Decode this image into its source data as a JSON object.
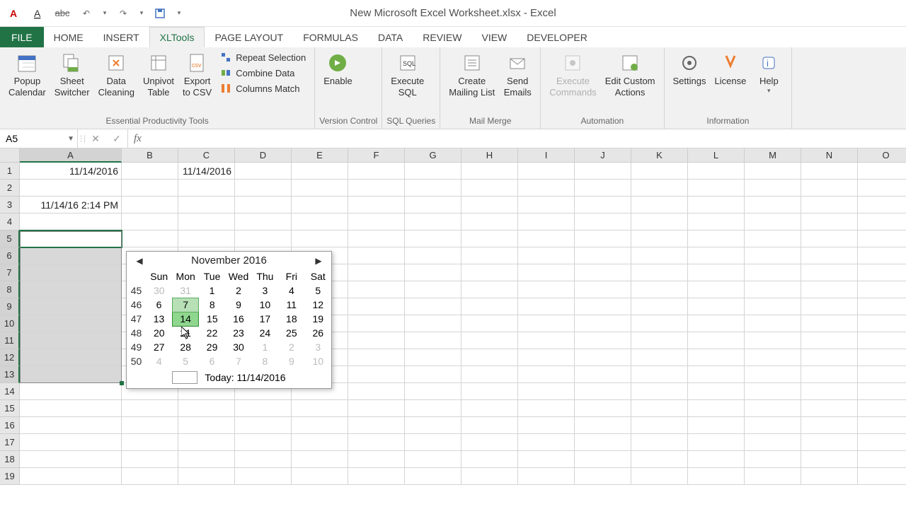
{
  "title": "New Microsoft Excel Worksheet.xlsx - Excel",
  "tabs": {
    "file": "FILE",
    "items": [
      "HOME",
      "INSERT",
      "XLTools",
      "PAGE LAYOUT",
      "FORMULAS",
      "DATA",
      "REVIEW",
      "VIEW",
      "DEVELOPER"
    ],
    "active": "XLTools"
  },
  "ribbon": {
    "groups": [
      {
        "label": "Essential Productivity Tools"
      },
      {
        "label": "Version Control"
      },
      {
        "label": "SQL Queries"
      },
      {
        "label": "Mail Merge"
      },
      {
        "label": "Automation"
      },
      {
        "label": "Information"
      }
    ],
    "popup_calendar": "Popup\nCalendar",
    "sheet_switcher": "Sheet\nSwitcher",
    "data_cleaning": "Data\nCleaning",
    "unpivot_table": "Unpivot\nTable",
    "export_csv": "Export\nto CSV",
    "repeat_selection": "Repeat Selection",
    "combine_data": "Combine Data",
    "columns_match": "Columns Match",
    "enable": "Enable",
    "execute_sql": "Execute\nSQL",
    "create_mailing": "Create\nMailing List",
    "send_emails": "Send\nEmails",
    "execute_commands": "Execute\nCommands",
    "edit_custom_actions": "Edit Custom\nActions",
    "settings": "Settings",
    "license": "License",
    "help": "Help"
  },
  "namebox": "A5",
  "formula": "",
  "columns": [
    "A",
    "B",
    "C",
    "D",
    "E",
    "F",
    "G",
    "H",
    "I",
    "J",
    "K",
    "L",
    "M",
    "N",
    "O"
  ],
  "rows": [
    "1",
    "2",
    "3",
    "4",
    "5",
    "6",
    "7",
    "8",
    "9",
    "10",
    "11",
    "12",
    "13",
    "14",
    "15",
    "16",
    "17",
    "18",
    "19"
  ],
  "cell_data": {
    "A1": "11/14/2016",
    "C1": "11/14/2016",
    "A3": "11/14/16 2:14 PM"
  },
  "calendar": {
    "month": "November 2016",
    "days": [
      "Sun",
      "Mon",
      "Tue",
      "Wed",
      "Thu",
      "Fri",
      "Sat"
    ],
    "weeks": [
      {
        "num": "45",
        "d": [
          {
            "v": "30",
            "o": true
          },
          {
            "v": "31",
            "o": true
          },
          {
            "v": "1"
          },
          {
            "v": "2"
          },
          {
            "v": "3"
          },
          {
            "v": "4"
          },
          {
            "v": "5"
          }
        ]
      },
      {
        "num": "46",
        "d": [
          {
            "v": "6"
          },
          {
            "v": "7",
            "hl": true
          },
          {
            "v": "8"
          },
          {
            "v": "9"
          },
          {
            "v": "10"
          },
          {
            "v": "11"
          },
          {
            "v": "12"
          }
        ]
      },
      {
        "num": "47",
        "d": [
          {
            "v": "13"
          },
          {
            "v": "14",
            "sel": true
          },
          {
            "v": "15"
          },
          {
            "v": "16"
          },
          {
            "v": "17"
          },
          {
            "v": "18"
          },
          {
            "v": "19"
          }
        ]
      },
      {
        "num": "48",
        "d": [
          {
            "v": "20"
          },
          {
            "v": "21"
          },
          {
            "v": "22"
          },
          {
            "v": "23"
          },
          {
            "v": "24"
          },
          {
            "v": "25"
          },
          {
            "v": "26"
          }
        ]
      },
      {
        "num": "49",
        "d": [
          {
            "v": "27"
          },
          {
            "v": "28"
          },
          {
            "v": "29"
          },
          {
            "v": "30"
          },
          {
            "v": "1",
            "o": true
          },
          {
            "v": "2",
            "o": true
          },
          {
            "v": "3",
            "o": true
          }
        ]
      },
      {
        "num": "50",
        "d": [
          {
            "v": "4",
            "o": true
          },
          {
            "v": "5",
            "o": true
          },
          {
            "v": "6",
            "o": true
          },
          {
            "v": "7",
            "o": true
          },
          {
            "v": "8",
            "o": true
          },
          {
            "v": "9",
            "o": true
          },
          {
            "v": "10",
            "o": true
          }
        ]
      }
    ],
    "today": "Today: 11/14/2016"
  }
}
